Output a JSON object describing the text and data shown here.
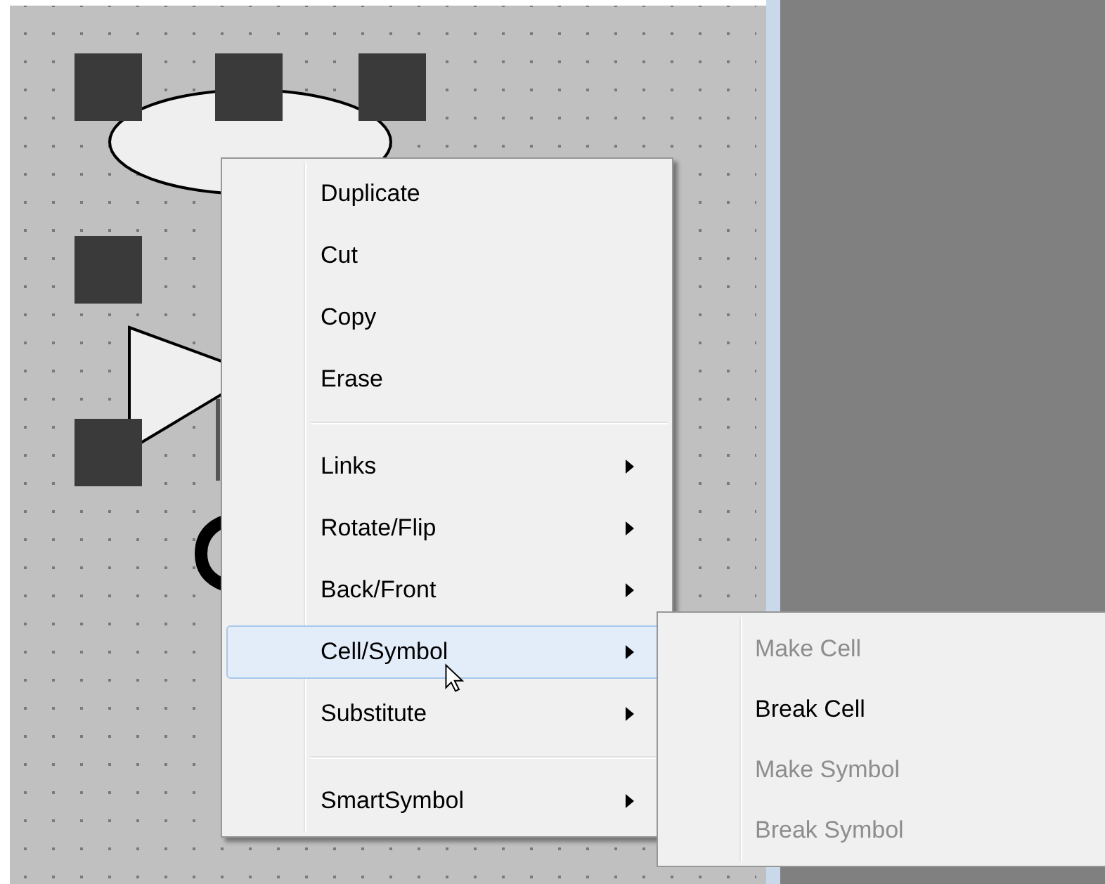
{
  "context_menu": {
    "items": [
      {
        "kind": "item",
        "label": "Duplicate",
        "submenu": false,
        "selected": false
      },
      {
        "kind": "item",
        "label": "Cut",
        "submenu": false,
        "selected": false
      },
      {
        "kind": "item",
        "label": "Copy",
        "submenu": false,
        "selected": false
      },
      {
        "kind": "item",
        "label": "Erase",
        "submenu": false,
        "selected": false
      },
      {
        "kind": "separator"
      },
      {
        "kind": "item",
        "label": "Links",
        "submenu": true,
        "selected": false
      },
      {
        "kind": "item",
        "label": "Rotate/Flip",
        "submenu": true,
        "selected": false
      },
      {
        "kind": "item",
        "label": "Back/Front",
        "submenu": true,
        "selected": false
      },
      {
        "kind": "item",
        "label": "Cell/Symbol",
        "submenu": true,
        "selected": true
      },
      {
        "kind": "item",
        "label": "Substitute",
        "submenu": true,
        "selected": false
      },
      {
        "kind": "separator"
      },
      {
        "kind": "item",
        "label": "SmartSymbol",
        "submenu": true,
        "selected": false
      }
    ]
  },
  "submenu": {
    "items": [
      {
        "label": "Make Cell",
        "disabled": true
      },
      {
        "label": "Break Cell",
        "disabled": false
      },
      {
        "label": "Make Symbol",
        "disabled": true
      },
      {
        "label": "Break Symbol",
        "disabled": true
      }
    ]
  }
}
